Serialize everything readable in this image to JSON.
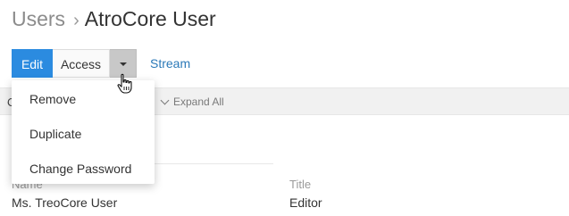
{
  "breadcrumb": {
    "root": "Users",
    "separator": "›",
    "current": "AtroCore User"
  },
  "toolbar": {
    "edit_label": "Edit",
    "access_label": "Access",
    "stream_label": "Stream"
  },
  "dropdown_menu": {
    "items": [
      {
        "label": "Remove"
      },
      {
        "label": "Duplicate"
      },
      {
        "label": "Change Password"
      }
    ]
  },
  "panel": {
    "partial_label": "O",
    "expand_all_label": "Expand All"
  },
  "fields": {
    "name": {
      "label": "Name",
      "value": "Ms. TreoCore User"
    },
    "title": {
      "label": "Title",
      "value": "Editor"
    }
  },
  "colors": {
    "primary": "#2b8be0",
    "link": "#2b79b8",
    "panel_bg": "#f1f1f1"
  },
  "icons": [
    "caret-down-icon",
    "chevron-down-icon",
    "hand-pointer-icon"
  ]
}
